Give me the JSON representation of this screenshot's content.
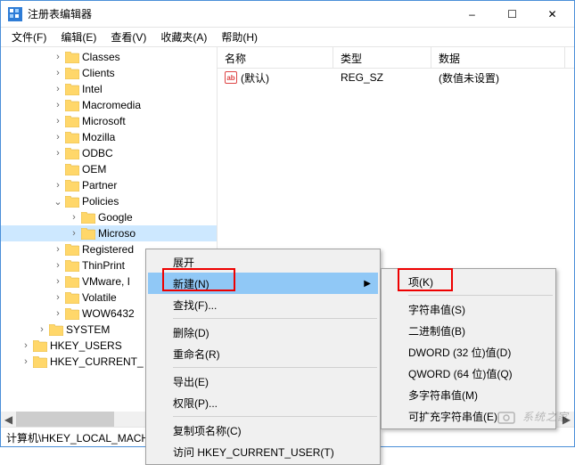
{
  "window": {
    "title": "注册表编辑器"
  },
  "menubar": {
    "file": "文件(F)",
    "edit": "编辑(E)",
    "view": "查看(V)",
    "favorites": "收藏夹(A)",
    "help": "帮助(H)"
  },
  "tree": {
    "items": [
      {
        "indent": 58,
        "exp": ">",
        "label": "Classes"
      },
      {
        "indent": 58,
        "exp": ">",
        "label": "Clients"
      },
      {
        "indent": 58,
        "exp": ">",
        "label": "Intel"
      },
      {
        "indent": 58,
        "exp": ">",
        "label": "Macromedia"
      },
      {
        "indent": 58,
        "exp": ">",
        "label": "Microsoft"
      },
      {
        "indent": 58,
        "exp": ">",
        "label": "Mozilla"
      },
      {
        "indent": 58,
        "exp": ">",
        "label": "ODBC"
      },
      {
        "indent": 58,
        "exp": "",
        "label": "OEM"
      },
      {
        "indent": 58,
        "exp": ">",
        "label": "Partner"
      },
      {
        "indent": 58,
        "exp": "v",
        "label": "Policies"
      },
      {
        "indent": 76,
        "exp": ">",
        "label": "Google"
      },
      {
        "indent": 76,
        "exp": ">",
        "label": "Microso",
        "selected": true
      },
      {
        "indent": 58,
        "exp": ">",
        "label": "Registered"
      },
      {
        "indent": 58,
        "exp": ">",
        "label": "ThinPrint"
      },
      {
        "indent": 58,
        "exp": ">",
        "label": "VMware, I"
      },
      {
        "indent": 58,
        "exp": ">",
        "label": "Volatile"
      },
      {
        "indent": 58,
        "exp": ">",
        "label": "WOW6432"
      },
      {
        "indent": 40,
        "exp": ">",
        "label": "SYSTEM"
      },
      {
        "indent": 22,
        "exp": ">",
        "label": "HKEY_USERS"
      },
      {
        "indent": 22,
        "exp": ">",
        "label": "HKEY_CURRENT_"
      }
    ]
  },
  "list": {
    "headers": {
      "name": "名称",
      "type": "类型",
      "data": "数据"
    },
    "col_widths": {
      "name": 130,
      "type": 110,
      "data": 150
    },
    "rows": [
      {
        "icon": "ab",
        "name": "(默认)",
        "type": "REG_SZ",
        "data": "(数值未设置)"
      }
    ]
  },
  "context_menu_main": {
    "expand": "展开",
    "new": "新建(N)",
    "find": "查找(F)...",
    "delete": "删除(D)",
    "rename": "重命名(R)",
    "export": "导出(E)",
    "permissions": "权限(P)...",
    "copy_key_name": "复制项名称(C)",
    "goto": "访问 HKEY_CURRENT_USER(T)"
  },
  "context_menu_new": {
    "key": "项(K)",
    "string": "字符串值(S)",
    "binary": "二进制值(B)",
    "dword": "DWORD (32 位)值(D)",
    "qword": "QWORD (64 位)值(Q)",
    "multi_string": "多字符串值(M)",
    "expand_string": "可扩充字符串值(E)"
  },
  "statusbar": {
    "path": "计算机\\HKEY_LOCAL_MACHI"
  },
  "watermark": "系统之家",
  "icons": {
    "minimize": "–",
    "maximize": "☐",
    "close": "✕",
    "submenu_arrow": "▶",
    "scroll_left": "◀",
    "scroll_right": "▶"
  }
}
